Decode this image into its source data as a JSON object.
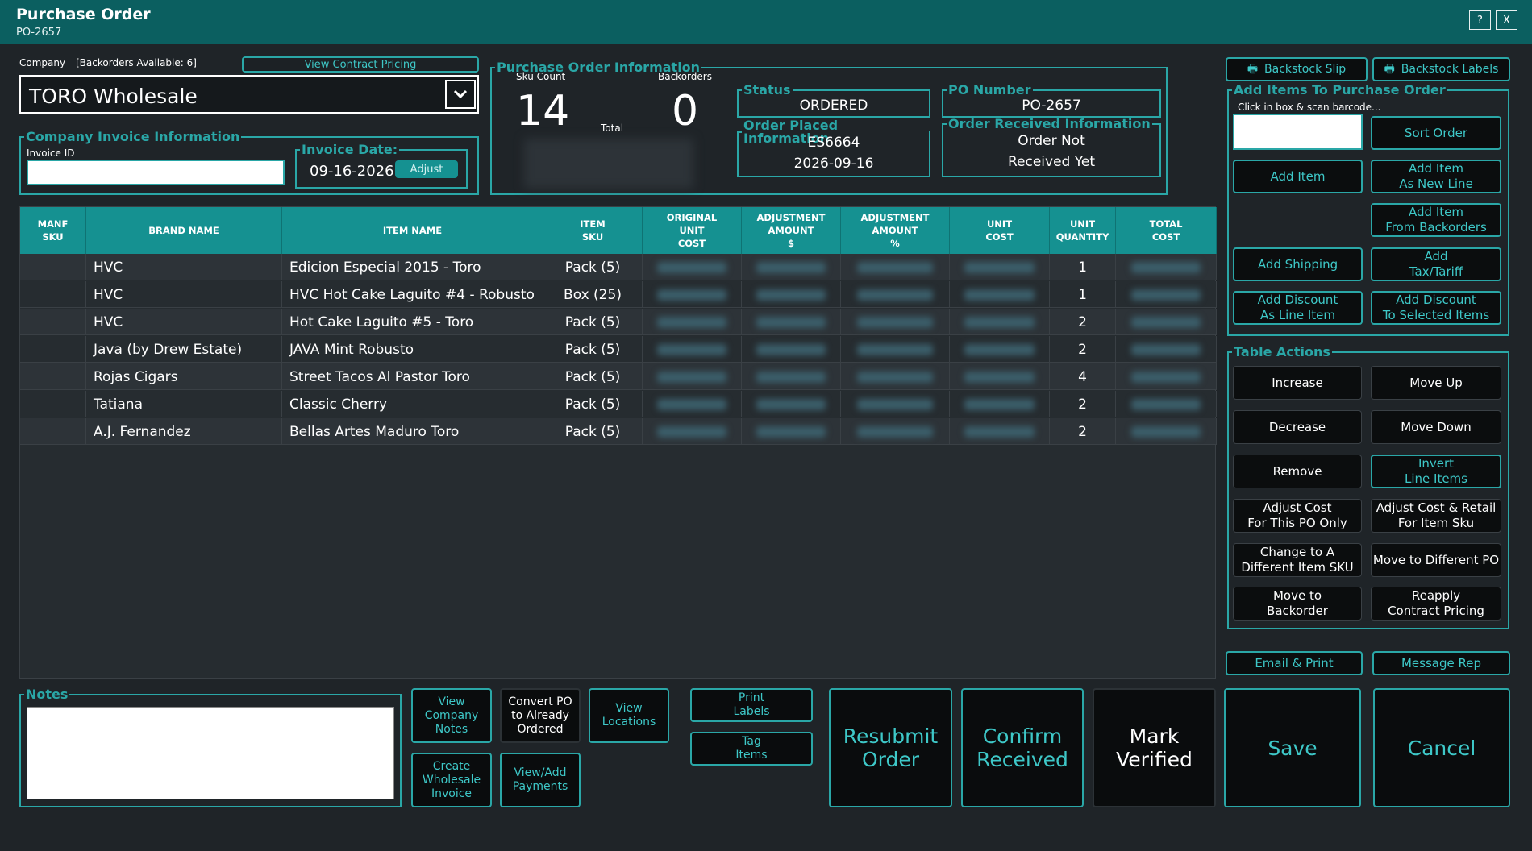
{
  "window": {
    "title": "Purchase Order",
    "subtitle": "PO-2657",
    "help_label": "?",
    "close_label": "X"
  },
  "company": {
    "label": "Company",
    "backorders_note": "[Backorders Available: 6]",
    "contract_pricing_label": "View Contract Pricing",
    "selected": "TORO Wholesale"
  },
  "invoice": {
    "legend": "Company Invoice Information",
    "id_label": "Invoice ID",
    "id_value": "",
    "date_legend": "Invoice Date:",
    "date_value": "09-16-2026",
    "adjust_label": "Adjust"
  },
  "po_info": {
    "legend": "Purchase Order Information",
    "sku_count_label": "Sku Count",
    "sku_count": "14",
    "backorders_label": "Backorders",
    "backorders": "0",
    "total_label": "Total",
    "status_legend": "Status",
    "status_value": "ORDERED",
    "po_number_legend": "PO Number",
    "po_number_value": "PO-2657",
    "placed_legend": "Order Placed Information",
    "placed_id": "ES6664",
    "placed_date": "2026-09-16",
    "received_legend": "Order Received Information",
    "received_line1": "Order Not",
    "received_line2": "Received Yet"
  },
  "table": {
    "headers": [
      {
        "l1": "MANF",
        "l2": "SKU",
        "l3": ""
      },
      {
        "l1": "BRAND NAME",
        "l2": "",
        "l3": ""
      },
      {
        "l1": "ITEM NAME",
        "l2": "",
        "l3": ""
      },
      {
        "l1": "ITEM",
        "l2": "SKU",
        "l3": ""
      },
      {
        "l1": "ORIGINAL",
        "l2": "UNIT",
        "l3": "COST"
      },
      {
        "l1": "ADJUSTMENT",
        "l2": "AMOUNT",
        "l3": "$"
      },
      {
        "l1": "ADJUSTMENT",
        "l2": "AMOUNT",
        "l3": "%"
      },
      {
        "l1": "UNIT",
        "l2": "COST",
        "l3": ""
      },
      {
        "l1": "UNIT",
        "l2": "QUANTITY",
        "l3": ""
      },
      {
        "l1": "TOTAL",
        "l2": "COST",
        "l3": ""
      }
    ],
    "rows": [
      {
        "manf_sku": "",
        "brand": "HVC",
        "item": "Edicion Especial 2015 - Toro",
        "sku": "Pack (5)",
        "qty": "1"
      },
      {
        "manf_sku": "",
        "brand": "HVC",
        "item": "HVC Hot Cake Laguito #4 - Robusto",
        "sku": "Box (25)",
        "qty": "1"
      },
      {
        "manf_sku": "",
        "brand": "HVC",
        "item": "Hot Cake Laguito #5 - Toro",
        "sku": "Pack (5)",
        "qty": "2"
      },
      {
        "manf_sku": "",
        "brand": "Java (by Drew Estate)",
        "item": "JAVA Mint Robusto",
        "sku": "Pack (5)",
        "qty": "2"
      },
      {
        "manf_sku": "",
        "brand": "Rojas Cigars",
        "item": "Street Tacos Al Pastor Toro",
        "sku": "Pack (5)",
        "qty": "4"
      },
      {
        "manf_sku": "",
        "brand": "Tatiana",
        "item": "Classic Cherry",
        "sku": "Pack (5)",
        "qty": "2"
      },
      {
        "manf_sku": "",
        "brand": "A.J. Fernandez",
        "item": "Bellas Artes Maduro Toro",
        "sku": "Pack (5)",
        "qty": "2"
      }
    ]
  },
  "right": {
    "backstock_slip": "Backstock Slip",
    "backstock_labels": "Backstock Labels",
    "add_items_legend": "Add Items To Purchase Order",
    "scan_hint": "Click in box & scan barcode...",
    "sort_order": "Sort Order",
    "add_item": "Add Item",
    "add_item_new_line_1": "Add Item",
    "add_item_new_line_2": "As New Line",
    "add_from_backorders_1": "Add Item",
    "add_from_backorders_2": "From Backorders",
    "add_shipping": "Add Shipping",
    "add_tax_1": "Add",
    "add_tax_2": "Tax/Tariff",
    "add_discount_line_1": "Add Discount",
    "add_discount_line_2": "As Line Item",
    "add_discount_sel_1": "Add Discount",
    "add_discount_sel_2": "To Selected Items",
    "table_actions_legend": "Table Actions",
    "increase": "Increase",
    "move_up": "Move Up",
    "decrease": "Decrease",
    "move_down": "Move Down",
    "remove": "Remove",
    "invert_1": "Invert",
    "invert_2": "Line Items",
    "adjust_po_1": "Adjust Cost",
    "adjust_po_2": "For This PO Only",
    "adjust_retail_1": "Adjust Cost & Retail",
    "adjust_retail_2": "For Item Sku",
    "change_sku_1": "Change to A",
    "change_sku_2": "Different Item SKU",
    "move_po": "Move to Different PO",
    "move_backorder_1": "Move to",
    "move_backorder_2": "Backorder",
    "reapply_1": "Reapply",
    "reapply_2": "Contract Pricing",
    "email_print": "Email & Print",
    "message_rep": "Message Rep"
  },
  "bottom": {
    "notes_legend": "Notes",
    "notes_value": "",
    "view_notes": [
      "View",
      "Company",
      "Notes"
    ],
    "convert_po": [
      "Convert PO",
      "to Already",
      "Ordered"
    ],
    "view_locations": [
      "View",
      "Locations"
    ],
    "create_invoice": [
      "Create",
      "Wholesale",
      "Invoice"
    ],
    "payments": [
      "View/Add",
      "Payments"
    ],
    "print_labels": [
      "Print",
      "Labels"
    ],
    "tag_items": [
      "Tag",
      "Items"
    ],
    "resubmit": [
      "Resubmit",
      "Order"
    ],
    "confirm": [
      "Confirm",
      "Received"
    ],
    "mark_verified": [
      "Mark",
      "Verified"
    ],
    "save": "Save",
    "cancel": "Cancel"
  },
  "colors": {
    "titlebar": "#0b5f60",
    "accent": "#2aa7a7",
    "header": "#159191",
    "background": "#1f2428"
  },
  "icons": {
    "dropdown": "chevron-down-icon",
    "printer": "printer-icon"
  }
}
